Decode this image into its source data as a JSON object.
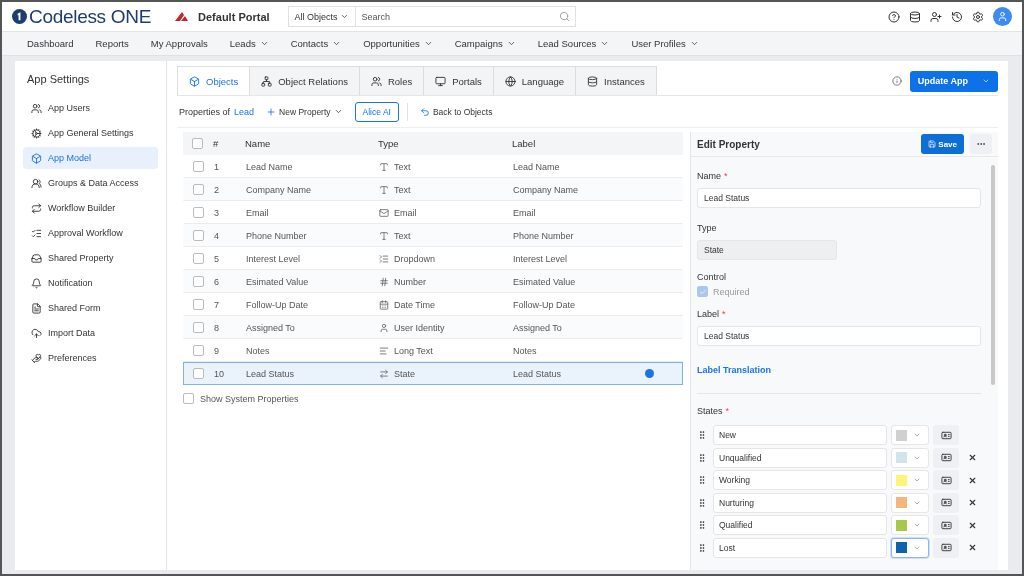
{
  "topbar": {
    "brand": "Codeless ONE",
    "portal": "Default Portal",
    "scope": "All Objects",
    "search_placeholder": "Search"
  },
  "nav": [
    {
      "label": "Dashboard",
      "dropdown": false
    },
    {
      "label": "Reports",
      "dropdown": false
    },
    {
      "label": "My Approvals",
      "dropdown": false
    },
    {
      "label": "Leads",
      "dropdown": true
    },
    {
      "label": "Contacts",
      "dropdown": true
    },
    {
      "label": "Opportunities",
      "dropdown": true
    },
    {
      "label": "Campaigns",
      "dropdown": true
    },
    {
      "label": "Lead Sources",
      "dropdown": true
    },
    {
      "label": "User Profiles",
      "dropdown": true
    }
  ],
  "sidebar": {
    "title": "App Settings",
    "items": [
      {
        "label": "App Users",
        "selected": false
      },
      {
        "label": "App General Settings",
        "selected": false
      },
      {
        "label": "App Model",
        "selected": true
      },
      {
        "label": "Groups & Data Access",
        "selected": false
      },
      {
        "label": "Workflow Builder",
        "selected": false
      },
      {
        "label": "Approval Workflow",
        "selected": false
      },
      {
        "label": "Shared Property",
        "selected": false
      },
      {
        "label": "Notification",
        "selected": false
      },
      {
        "label": "Shared Form",
        "selected": false
      },
      {
        "label": "Import Data",
        "selected": false
      },
      {
        "label": "Preferences",
        "selected": false
      }
    ]
  },
  "tabs": [
    {
      "label": "Objects",
      "selected": true
    },
    {
      "label": "Object Relations",
      "selected": false
    },
    {
      "label": "Roles",
      "selected": false
    },
    {
      "label": "Portals",
      "selected": false
    },
    {
      "label": "Language",
      "selected": false
    },
    {
      "label": "Instances",
      "selected": false
    }
  ],
  "update_button": "Update App",
  "toolbar": {
    "prefix": "Properties of",
    "object": "Lead",
    "new_property": "New Property",
    "ai_button": "Alice AI",
    "back": "Back to Objects"
  },
  "table": {
    "all_checked": false,
    "columns": [
      "#",
      "Name",
      "Type",
      "Label"
    ],
    "rows": [
      {
        "num": "1",
        "name": "Lead Name",
        "type": "Text",
        "kind": "text",
        "label": "Lead Name",
        "checked": false,
        "selected": false
      },
      {
        "num": "2",
        "name": "Company Name",
        "type": "Text",
        "kind": "text",
        "label": "Company Name",
        "checked": false,
        "selected": false
      },
      {
        "num": "3",
        "name": "Email",
        "type": "Email",
        "kind": "email",
        "label": "Email",
        "checked": false,
        "selected": false
      },
      {
        "num": "4",
        "name": "Phone Number",
        "type": "Text",
        "kind": "text",
        "label": "Phone Number",
        "checked": false,
        "selected": false
      },
      {
        "num": "5",
        "name": "Interest Level",
        "type": "Dropdown",
        "kind": "dropdown",
        "label": "Interest Level",
        "checked": false,
        "selected": false
      },
      {
        "num": "6",
        "name": "Esimated Value",
        "type": "Number",
        "kind": "number",
        "label": "Esimated Value",
        "checked": false,
        "selected": false
      },
      {
        "num": "7",
        "name": "Follow-Up Date",
        "type": "Date Time",
        "kind": "datetime",
        "label": "Follow-Up Date",
        "checked": false,
        "selected": false
      },
      {
        "num": "8",
        "name": "Assigned To",
        "type": "User Identity",
        "kind": "user",
        "label": "Assigned To",
        "checked": false,
        "selected": false
      },
      {
        "num": "9",
        "name": "Notes",
        "type": "Long Text",
        "kind": "longtext",
        "label": "Notes",
        "checked": false,
        "selected": false
      },
      {
        "num": "10",
        "name": "Lead Status",
        "type": "State",
        "kind": "state",
        "label": "Lead Status",
        "checked": false,
        "selected": true
      }
    ]
  },
  "show_system": {
    "label": "Show System Properties",
    "checked": false
  },
  "edit": {
    "title": "Edit Property",
    "save": "Save",
    "name_label": "Name",
    "name_mark": "*",
    "label_mark": "*",
    "states_mark": "*",
    "name_value": "Lead Status",
    "type_label": "Type",
    "type_value": "State",
    "control_label": "Control",
    "required_label": "Required",
    "required_checked": true,
    "label_label": "Label",
    "label_value": "Lead Status",
    "translation_link": "Label Translation",
    "states_label": "States",
    "states": [
      {
        "name": "New",
        "color": "#d0d0d0",
        "removable": false,
        "focused": false
      },
      {
        "name": "Unqualified",
        "color": "#cfe5ec",
        "removable": true,
        "focused": false
      },
      {
        "name": "Working",
        "color": "#fdf57a",
        "removable": true,
        "focused": false
      },
      {
        "name": "Nurturing",
        "color": "#f6b57a",
        "removable": true,
        "focused": false
      },
      {
        "name": "Qualified",
        "color": "#a6c94a",
        "removable": true,
        "focused": false
      },
      {
        "name": "Lost",
        "color": "#1261ad",
        "removable": true,
        "focused": true
      }
    ]
  }
}
